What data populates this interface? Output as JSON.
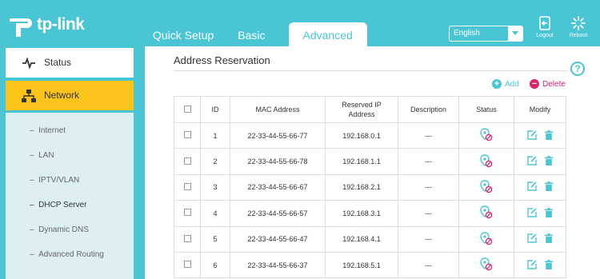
{
  "brand": "tp-link",
  "tabs": [
    {
      "label": "Quick Setup",
      "active": false
    },
    {
      "label": "Basic",
      "active": false
    },
    {
      "label": "Advanced",
      "active": true
    }
  ],
  "language": "English",
  "header_buttons": {
    "logout": "Logout",
    "reboot": "Reboot"
  },
  "sidebar": {
    "items": [
      {
        "label": "Status",
        "icon": "pulse-icon",
        "active": false
      },
      {
        "label": "Network",
        "icon": "network-icon",
        "active": true
      }
    ],
    "subitems": [
      {
        "label": "Internet",
        "active": false
      },
      {
        "label": "LAN",
        "active": false
      },
      {
        "label": "IPTV/VLAN",
        "active": false
      },
      {
        "label": "DHCP Server",
        "active": true
      },
      {
        "label": "Dynamic DNS",
        "active": false
      },
      {
        "label": "Advanced Routing",
        "active": false
      }
    ]
  },
  "main": {
    "title": "Address Reservation",
    "help": "?",
    "add_label": "Add",
    "delete_label": "Delete",
    "table": {
      "headers": {
        "id": "ID",
        "mac": "MAC Address",
        "ip": "Reserved IP Address",
        "desc": "Description",
        "status": "Status",
        "modify": "Modify"
      },
      "rows": [
        {
          "id": "1",
          "mac": "22-33-44-55-66-77",
          "ip": "192.168.0.1",
          "desc": "---"
        },
        {
          "id": "2",
          "mac": "22-33-44-55-66-78",
          "ip": "192.168.1.1",
          "desc": "---"
        },
        {
          "id": "3",
          "mac": "22-33-44-55-66-67",
          "ip": "192.168.2.1",
          "desc": "---"
        },
        {
          "id": "4",
          "mac": "22-33-44-55-66-57",
          "ip": "192.168.3.1",
          "desc": "---"
        },
        {
          "id": "5",
          "mac": "22-33-44-55-66-47",
          "ip": "192.168.4.1",
          "desc": "---"
        },
        {
          "id": "6",
          "mac": "22-33-44-55-66-37",
          "ip": "192.168.5.1",
          "desc": "---"
        }
      ]
    }
  },
  "colors": {
    "brand": "#4ac5d4",
    "active_nav": "#fcc41a",
    "delete": "#d6246e"
  }
}
